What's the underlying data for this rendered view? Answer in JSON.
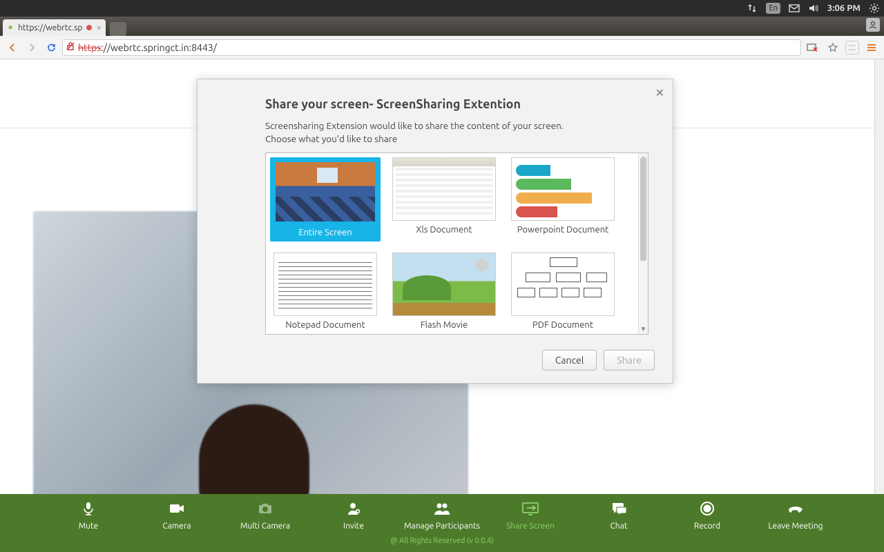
{
  "os": {
    "lang": "En",
    "time": "3:06 PM"
  },
  "browser": {
    "tab_title": "https://webrtc.sp",
    "url_protocol": "https",
    "url_rest": "://webrtc.springct.in:8443/"
  },
  "dialog": {
    "title": "Share your screen- ScreenSharing Extention",
    "desc_line1": "Screensharing Extension would like to share the content of your screen.",
    "desc_line2": "Choose what you'd like to share",
    "cancel": "Cancel",
    "share": "Share",
    "options": [
      {
        "label": "Entire Screen",
        "selected": true
      },
      {
        "label": "Xls Document",
        "selected": false
      },
      {
        "label": "Powerpoint Document",
        "selected": false
      },
      {
        "label": "Notepad Document",
        "selected": false
      },
      {
        "label": "Flash Movie",
        "selected": false
      },
      {
        "label": "PDF Document",
        "selected": false
      }
    ]
  },
  "toolbar": {
    "items": [
      {
        "label": "Mute",
        "icon": "mic"
      },
      {
        "label": "Camera",
        "icon": "camera"
      },
      {
        "label": "Multi Camera",
        "icon": "multicam",
        "dim": true
      },
      {
        "label": "Invite",
        "icon": "invite"
      },
      {
        "label": "Manage Participants",
        "icon": "participants"
      },
      {
        "label": "Share Screen",
        "icon": "share",
        "active": true
      },
      {
        "label": "Chat",
        "icon": "chat"
      },
      {
        "label": "Record",
        "icon": "record"
      },
      {
        "label": "Leave Meeting",
        "icon": "leave"
      }
    ],
    "copyright": "@ All Rights Reserved (v 0.0.4)"
  }
}
